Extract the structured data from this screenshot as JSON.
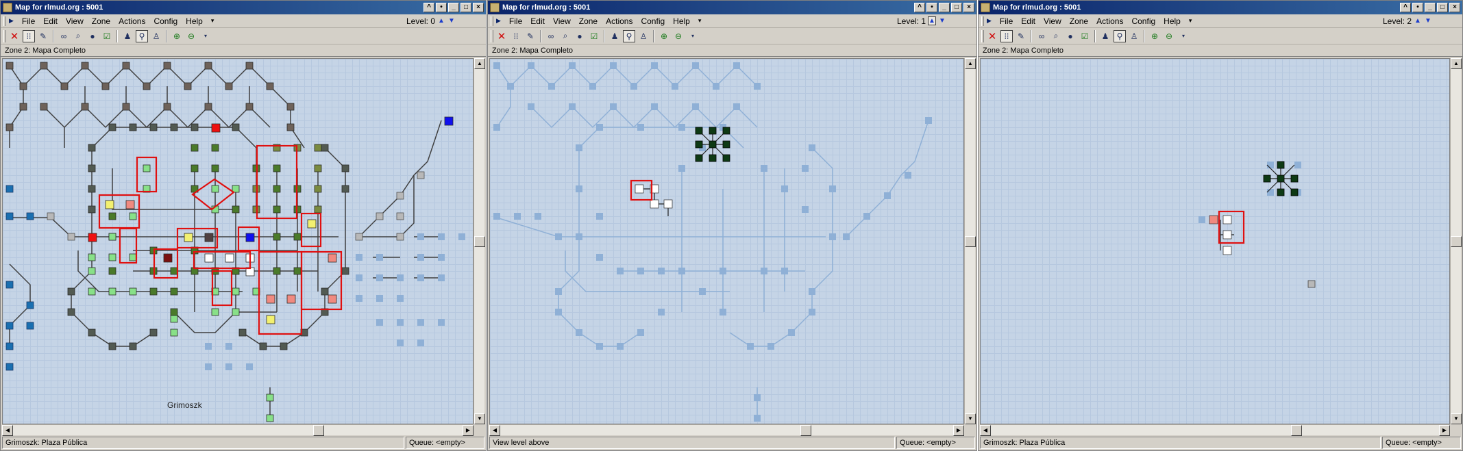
{
  "colors": {
    "map_bg": "#c5d4e6",
    "room_current": "#5a5a5a",
    "room_faded": "#8fb0d6",
    "highlight": "#e01010",
    "title_bar": "#0a246a"
  },
  "windows": [
    {
      "title": "Map for rlmud.org : 5001",
      "menu": [
        "File",
        "Edit",
        "View",
        "Zone",
        "Actions",
        "Config",
        "Help"
      ],
      "level_label": "Level: 0",
      "zone_label": "Zone 2: Mapa Completo",
      "map_label": "Grimoszk",
      "status_left": "Grimoszk: Plaza Pública",
      "status_right": "Queue: <empty>"
    },
    {
      "title": "Map for rlmud.org : 5001",
      "menu": [
        "File",
        "Edit",
        "View",
        "Zone",
        "Actions",
        "Config",
        "Help"
      ],
      "level_label": "Level: 1",
      "zone_label": "Zone 2: Mapa Completo",
      "status_left": "View level above",
      "status_right": "Queue: <empty>"
    },
    {
      "title": "Map for rlmud.org : 5001",
      "menu": [
        "File",
        "Edit",
        "View",
        "Zone",
        "Actions",
        "Config",
        "Help"
      ],
      "level_label": "Level: 2",
      "zone_label": "Zone 2: Mapa Completo",
      "status_left": "Grimoszk: Plaza Pública",
      "status_right": "Queue: <empty>"
    }
  ],
  "icons": {
    "close_tool": "close-icon",
    "grid_tool": "grid-icon",
    "select_tool": "select-icon",
    "find_tool": "binoculars-icon",
    "zoom_tool": "zoom-icon"
  }
}
